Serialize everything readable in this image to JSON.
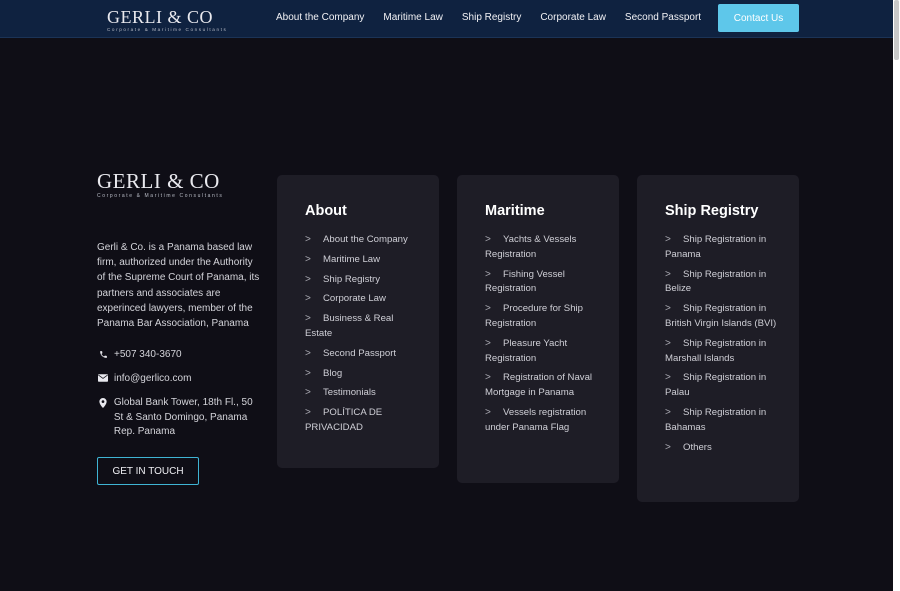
{
  "header": {
    "logo_name": "GERLI & CO",
    "logo_tagline": "Corporate & Maritime Consultants",
    "nav": [
      "About the Company",
      "Maritime Law",
      "Ship Registry",
      "Corporate Law",
      "Second Passport"
    ],
    "contact_button": "Contact Us"
  },
  "company": {
    "logo_name": "GERLI & CO",
    "logo_tagline": "Corporate & Maritime Consultants",
    "description": "Gerli & Co. is a Panama based law firm, authorized under the Authority of the Supreme Court of Panama, its partners and associates are experinced lawyers, member of the Panama Bar Association, Panama",
    "phone": "+507 340-3670",
    "email": "info@gerlico.com",
    "address": "Global Bank Tower, 18th Fl., 50 St & Santo Domingo, Panama Rep. Panama",
    "cta": "GET IN TOUCH"
  },
  "cards": {
    "about": {
      "title": "About",
      "items": [
        "About the Company",
        "Maritime Law",
        "Ship Registry",
        "Corporate Law",
        "Business & Real Estate",
        "Second Passport",
        "Blog",
        "Testimonials",
        "POLÍTICA DE PRIVACIDAD"
      ]
    },
    "maritime": {
      "title": "Maritime",
      "items": [
        "Yachts & Vessels Registration",
        "Fishing Vessel Registration",
        "Procedure for Ship Registration",
        "Pleasure Yacht Registration",
        "Registration of Naval Mortgage in Panama",
        "Vessels registration under Panama Flag"
      ]
    },
    "ship_registry": {
      "title": "Ship Registry",
      "items": [
        "Ship Registration in Panama",
        "Ship Registration in Belize",
        "Ship Registration in British Virgin Islands (BVI)",
        "Ship Registration in Marshall Islands",
        "Ship Registration in Palau",
        "Ship Registration in Bahamas",
        "Others"
      ]
    }
  },
  "colors": {
    "header_bg": "#0f2240",
    "page_bg": "#0f0e16",
    "card_bg": "#1e1d26",
    "accent": "#5ec7ea"
  },
  "icons": {
    "phone": "phone-icon",
    "email": "envelope-icon",
    "address": "map-pin-icon",
    "chevron": "chevron-right-icon"
  }
}
